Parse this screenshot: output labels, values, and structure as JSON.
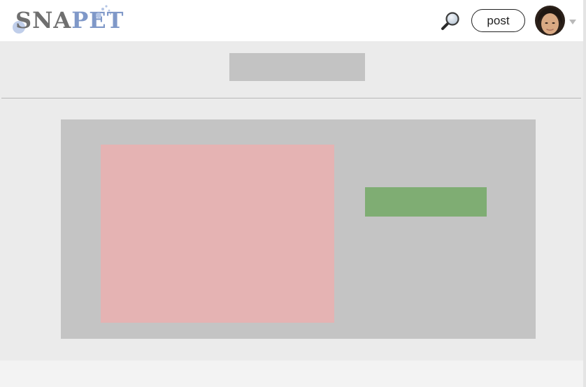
{
  "header": {
    "logo": {
      "part1": "SNA",
      "part2": "PET"
    },
    "search": {
      "icon": "magnifying-glass-icon"
    },
    "post_label": "post",
    "avatar": {
      "icon": "user-avatar"
    },
    "menu": {
      "icon": "caret-down-icon"
    }
  },
  "colors": {
    "header_bg": "#ffffff",
    "page_bg": "#ebebeb",
    "panel_bg": "#c4c4c4",
    "placeholder_gray": "#c3c3c3",
    "image_placeholder": "#e5b3b3",
    "action_placeholder": "#7fad73",
    "logo_gray": "#6f6f6f",
    "logo_blue": "#7f98c8"
  }
}
